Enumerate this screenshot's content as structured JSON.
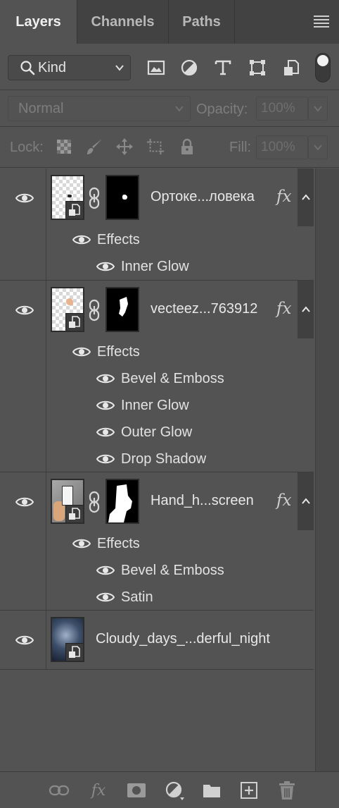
{
  "tabs": [
    {
      "label": "Layers",
      "active": true
    },
    {
      "label": "Channels",
      "active": false
    },
    {
      "label": "Paths",
      "active": false
    }
  ],
  "filter": {
    "kind_label": "Kind",
    "icons": [
      "image-filter-icon",
      "adjustment-filter-icon",
      "type-filter-icon",
      "shape-filter-icon",
      "smart-object-filter-icon"
    ]
  },
  "blend": {
    "mode": "Normal",
    "opacity_label": "Opacity:",
    "opacity_value": "100%"
  },
  "lock": {
    "label": "Lock:",
    "fill_label": "Fill:",
    "fill_value": "100%",
    "icons": [
      "lock-transparent-pixels-icon",
      "lock-image-pixels-icon",
      "lock-position-icon",
      "lock-artboard-icon",
      "lock-all-icon"
    ]
  },
  "layers": [
    {
      "name": "Ортоке...ловека",
      "has_fx": true,
      "fx_label": "fx",
      "effects_label": "Effects",
      "effects": [
        "Inner Glow"
      ]
    },
    {
      "name": "vecteez...763912",
      "has_fx": true,
      "fx_label": "fx",
      "effects_label": "Effects",
      "effects": [
        "Bevel & Emboss",
        "Inner Glow",
        "Outer Glow",
        "Drop Shadow"
      ]
    },
    {
      "name": "Hand_h...screen",
      "has_fx": true,
      "fx_label": "fx",
      "effects_label": "Effects",
      "effects": [
        "Bevel & Emboss",
        "Satin"
      ]
    },
    {
      "name": "Cloudy_days_...derful_night",
      "has_fx": false
    }
  ],
  "bottom_bar": {
    "fx_label": "fx",
    "icons": [
      "link-layers-icon",
      "add-layer-style-icon",
      "add-mask-icon",
      "new-adjustment-layer-icon",
      "new-group-icon",
      "new-layer-icon",
      "delete-layer-icon"
    ]
  }
}
